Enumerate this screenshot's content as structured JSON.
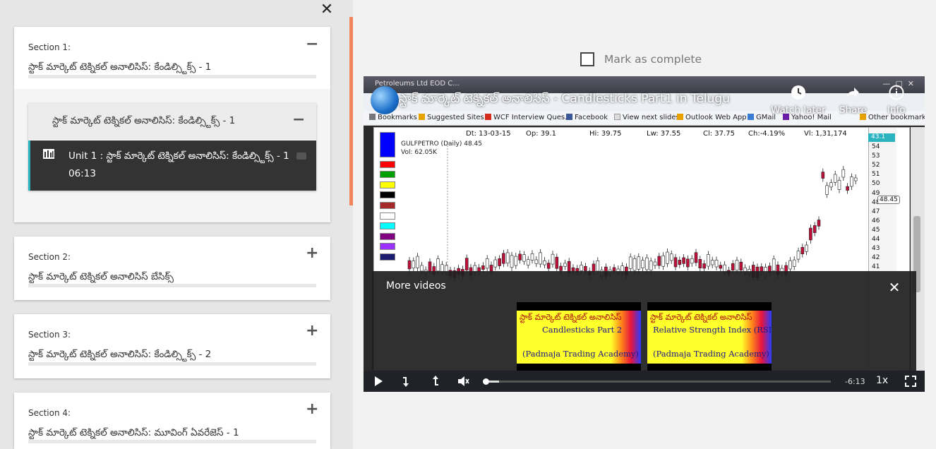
{
  "sidebar": {
    "sections": [
      {
        "label": "Section 1:",
        "title": "స్టాక్ మార్కెట్ టెక్నికల్ అనాలిసిస్: కేండిల్స్టిక్స్ - 1",
        "expanded": true
      },
      {
        "label": "Section 2:",
        "title": "స్టాక్ మార్కెట్ టెక్నికల్ అనాలిసిస్ బేసిక్స్",
        "expanded": false
      },
      {
        "label": "Section 3:",
        "title": "స్టాక్ మార్కెట్ టెక్నికల్ అనాలిసిస్: కేండిల్స్టిక్స్ - 2",
        "expanded": false
      },
      {
        "label": "Section 4:",
        "title": "స్టాక్ మార్కెట్ టెక్నికల్ అనాలిసిస్: మూవింగ్ ఏవరేజెస్ - 1",
        "expanded": false
      }
    ],
    "subsection": {
      "title": "స్టాక్ మార్కెట్ టెక్నికల్ అనాలిసిస్: కేండిల్స్టిక్స్ - 1",
      "unit_title": "Unit 1 : స్టాక్ మార్కెట్ టెక్నికల్ అనాలిసిస్: కేండిల్స్టిక్స్ - 1",
      "unit_time": "06:13"
    }
  },
  "main": {
    "mark_complete": "Mark as complete"
  },
  "video": {
    "title": "స్టాక్ మార్కెట్ టెక్నికల్ అనాలిసిస్ - Candlesticks Part1 in Telugu",
    "tab_text": "Petroleums Ltd EOD C...",
    "actions": [
      {
        "label": "Watch later",
        "icon": "clock-icon"
      },
      {
        "label": "Share",
        "icon": "share-arrow-icon"
      },
      {
        "label": "Info",
        "icon": "info-icon"
      }
    ],
    "bookmarks": [
      "Bookmarks",
      "Suggested Sites",
      "WCF Interview Ques...",
      "Facebook",
      "View next slides",
      "Outlook Web App",
      "GMail",
      "Yahoo! Mail",
      "Other bookmarks"
    ],
    "ohlc": {
      "dt": "Dt: 13-03-15",
      "op": "Op: 39.1",
      "hi": "Hi: 39.75",
      "lw": "Lw: 37.55",
      "cl": "Cl: 37.75",
      "ch": "Ch:-4.19%",
      "vl": "Vl: 1,31,174"
    },
    "symbol_label": "GULFPETRO (Daily) 48.45",
    "vol_label": "Vol: 62.05K",
    "price_ticks": [
      "43.1",
      "54",
      "53",
      "52",
      "51",
      "50",
      "49",
      "48",
      "47",
      "46",
      "45",
      "44",
      "43",
      "42",
      "41"
    ],
    "price_tag": "48.45",
    "more_videos_title": "More videos",
    "more_videos": [
      {
        "line1": "స్టాక్ మార్కెట్ టెక్నికల్ అనాలిసిస్",
        "line2": "Candlesticks Part 2",
        "line3": "(Padmaja Trading Academy)"
      },
      {
        "line1": "స్టాక్ మార్కెట్ టెక్నికల్ అనాలిసిస్",
        "line2": "Relative Strength Index (RSI)",
        "line3": "(Padmaja Trading Academy)"
      }
    ],
    "time_remaining": "-6:13",
    "speed": "1x",
    "progress_fraction": 0.04
  }
}
